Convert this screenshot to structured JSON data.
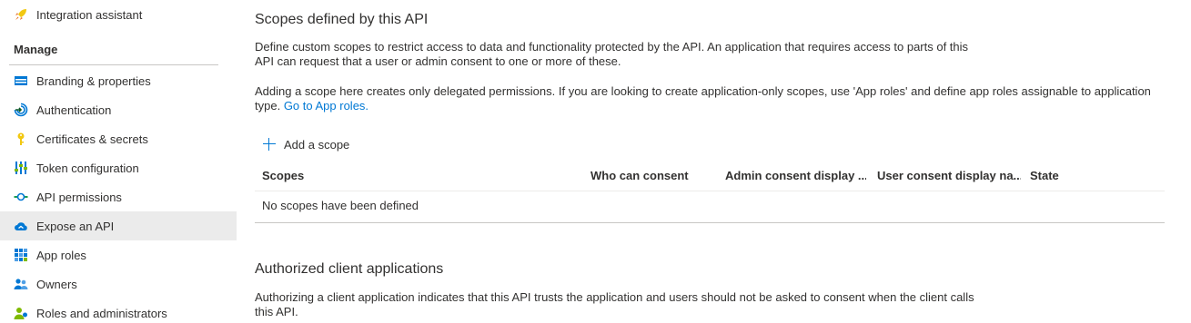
{
  "sidebar": {
    "top_item": {
      "label": "Integration assistant",
      "icon": "rocket-icon"
    },
    "section_header": "Manage",
    "items": [
      {
        "label": "Branding & properties",
        "icon": "branding-icon"
      },
      {
        "label": "Authentication",
        "icon": "authentication-icon"
      },
      {
        "label": "Certificates & secrets",
        "icon": "key-icon"
      },
      {
        "label": "Token configuration",
        "icon": "token-config-icon"
      },
      {
        "label": "API permissions",
        "icon": "api-permissions-icon"
      },
      {
        "label": "Expose an API",
        "icon": "cloud-icon",
        "active": true
      },
      {
        "label": "App roles",
        "icon": "app-roles-icon"
      },
      {
        "label": "Owners",
        "icon": "owners-icon"
      },
      {
        "label": "Roles and administrators",
        "icon": "roles-admin-icon"
      }
    ]
  },
  "scopes": {
    "title": "Scopes defined by this API",
    "desc1_line1": "Define custom scopes to restrict access to data and functionality protected by the API. An application that requires access to parts of this",
    "desc1_line2": "API can request that a user or admin consent to one or more of these.",
    "desc2_line1": "Adding a scope here creates only delegated permissions. If you are looking to create application-only scopes, use 'App roles' and define app roles assignable to application",
    "desc2_line2": "type.",
    "desc2_link": "Go to App roles.",
    "add_label": "Add a scope",
    "columns": [
      "Scopes",
      "Who can consent",
      "Admin consent display ...",
      "User consent display na...",
      "State"
    ],
    "empty_message": "No scopes have been defined"
  },
  "authorized": {
    "title": "Authorized client applications",
    "desc_line1": "Authorizing a client application indicates that this API trusts the application and users should not be asked to consent when the client calls",
    "desc_line2": "this API."
  },
  "colors": {
    "accent": "#0078d4",
    "active_bg": "#ebebeb",
    "text": "#323130"
  }
}
